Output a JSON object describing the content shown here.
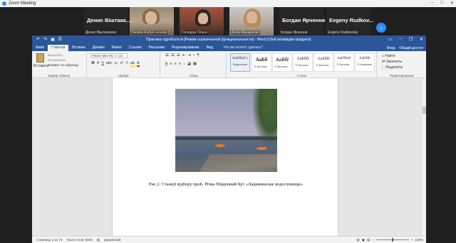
{
  "zoom": {
    "window_title": "Zoom Meeting",
    "participants": [
      {
        "big_name": "Денис Віштака...",
        "small_name": "Денис Віштакалюк",
        "video": false
      },
      {
        "big_name": "",
        "small_name": "Natalia Rudyk-Leuska",
        "video": true
      },
      {
        "big_name": "",
        "small_name": "Гончарук Ольга",
        "video": true
      },
      {
        "big_name": "",
        "small_name": "Алла Макаренко",
        "video": true
      },
      {
        "big_name": "Богдан Ярчення",
        "small_name": "Богдан Ярчення",
        "video": false
      },
      {
        "big_name": "Evgeny Rudkov...",
        "small_name": "Evgeny Rudkovsky",
        "video": false
      }
    ],
    "next_icon_glyph": "›"
  },
  "word": {
    "window_title": "Практика гідробіологія [Режим ограниченной функциональности] - Word (Сбой активации продукта)",
    "tabs": [
      "Файл",
      "Главная",
      "Вставка",
      "Дизайн",
      "Макет",
      "Ссылки",
      "Рассылки",
      "Рецензирование",
      "Вид"
    ],
    "active_tab": "Главная",
    "tell_me": "Что вы хотите сделать?",
    "sign_in": "Вход",
    "share": "Общий доступ",
    "clipboard": {
      "paste": "Вставить",
      "cut": "Вырезать",
      "copy": "Копировать",
      "format_painter": "Формат по образцу",
      "group_label": "Буфер обмена"
    },
    "font": {
      "name": "Times New Ro",
      "size": "14",
      "group_label": "Шрифт"
    },
    "paragraph_label": "Абзац",
    "styles": [
      {
        "sample": "АаБбВвГг,",
        "name": "Выделение"
      },
      {
        "sample": "АаБб",
        "name": "¶ Заголов..."
      },
      {
        "sample": "АаБбі",
        "name": "¶ Заголов..."
      },
      {
        "sample": "АаБбВ",
        "name": "¶ Заголов..."
      },
      {
        "sample": "АаБбВ",
        "name": "¶ Заголов..."
      },
      {
        "sample": "АаБбВвГ",
        "name": "¶ Заголов..."
      },
      {
        "sample": "АаБбВі",
        "name": "¶ Название"
      }
    ],
    "styles_label": "Стили",
    "editing": {
      "find": "Найти",
      "replace": "Заменить",
      "select": "Выделить",
      "group_label": "Редактирование"
    },
    "caption": "Рис.2. Станції відбору проб. Річка Південний Буг «Ладижинське водосховище»",
    "status": {
      "page": "Страница 1 из 73",
      "words": "Число слов: 8030",
      "language": "украинский",
      "zoom": "100%"
    },
    "marker_color": "#f07b1f"
  }
}
